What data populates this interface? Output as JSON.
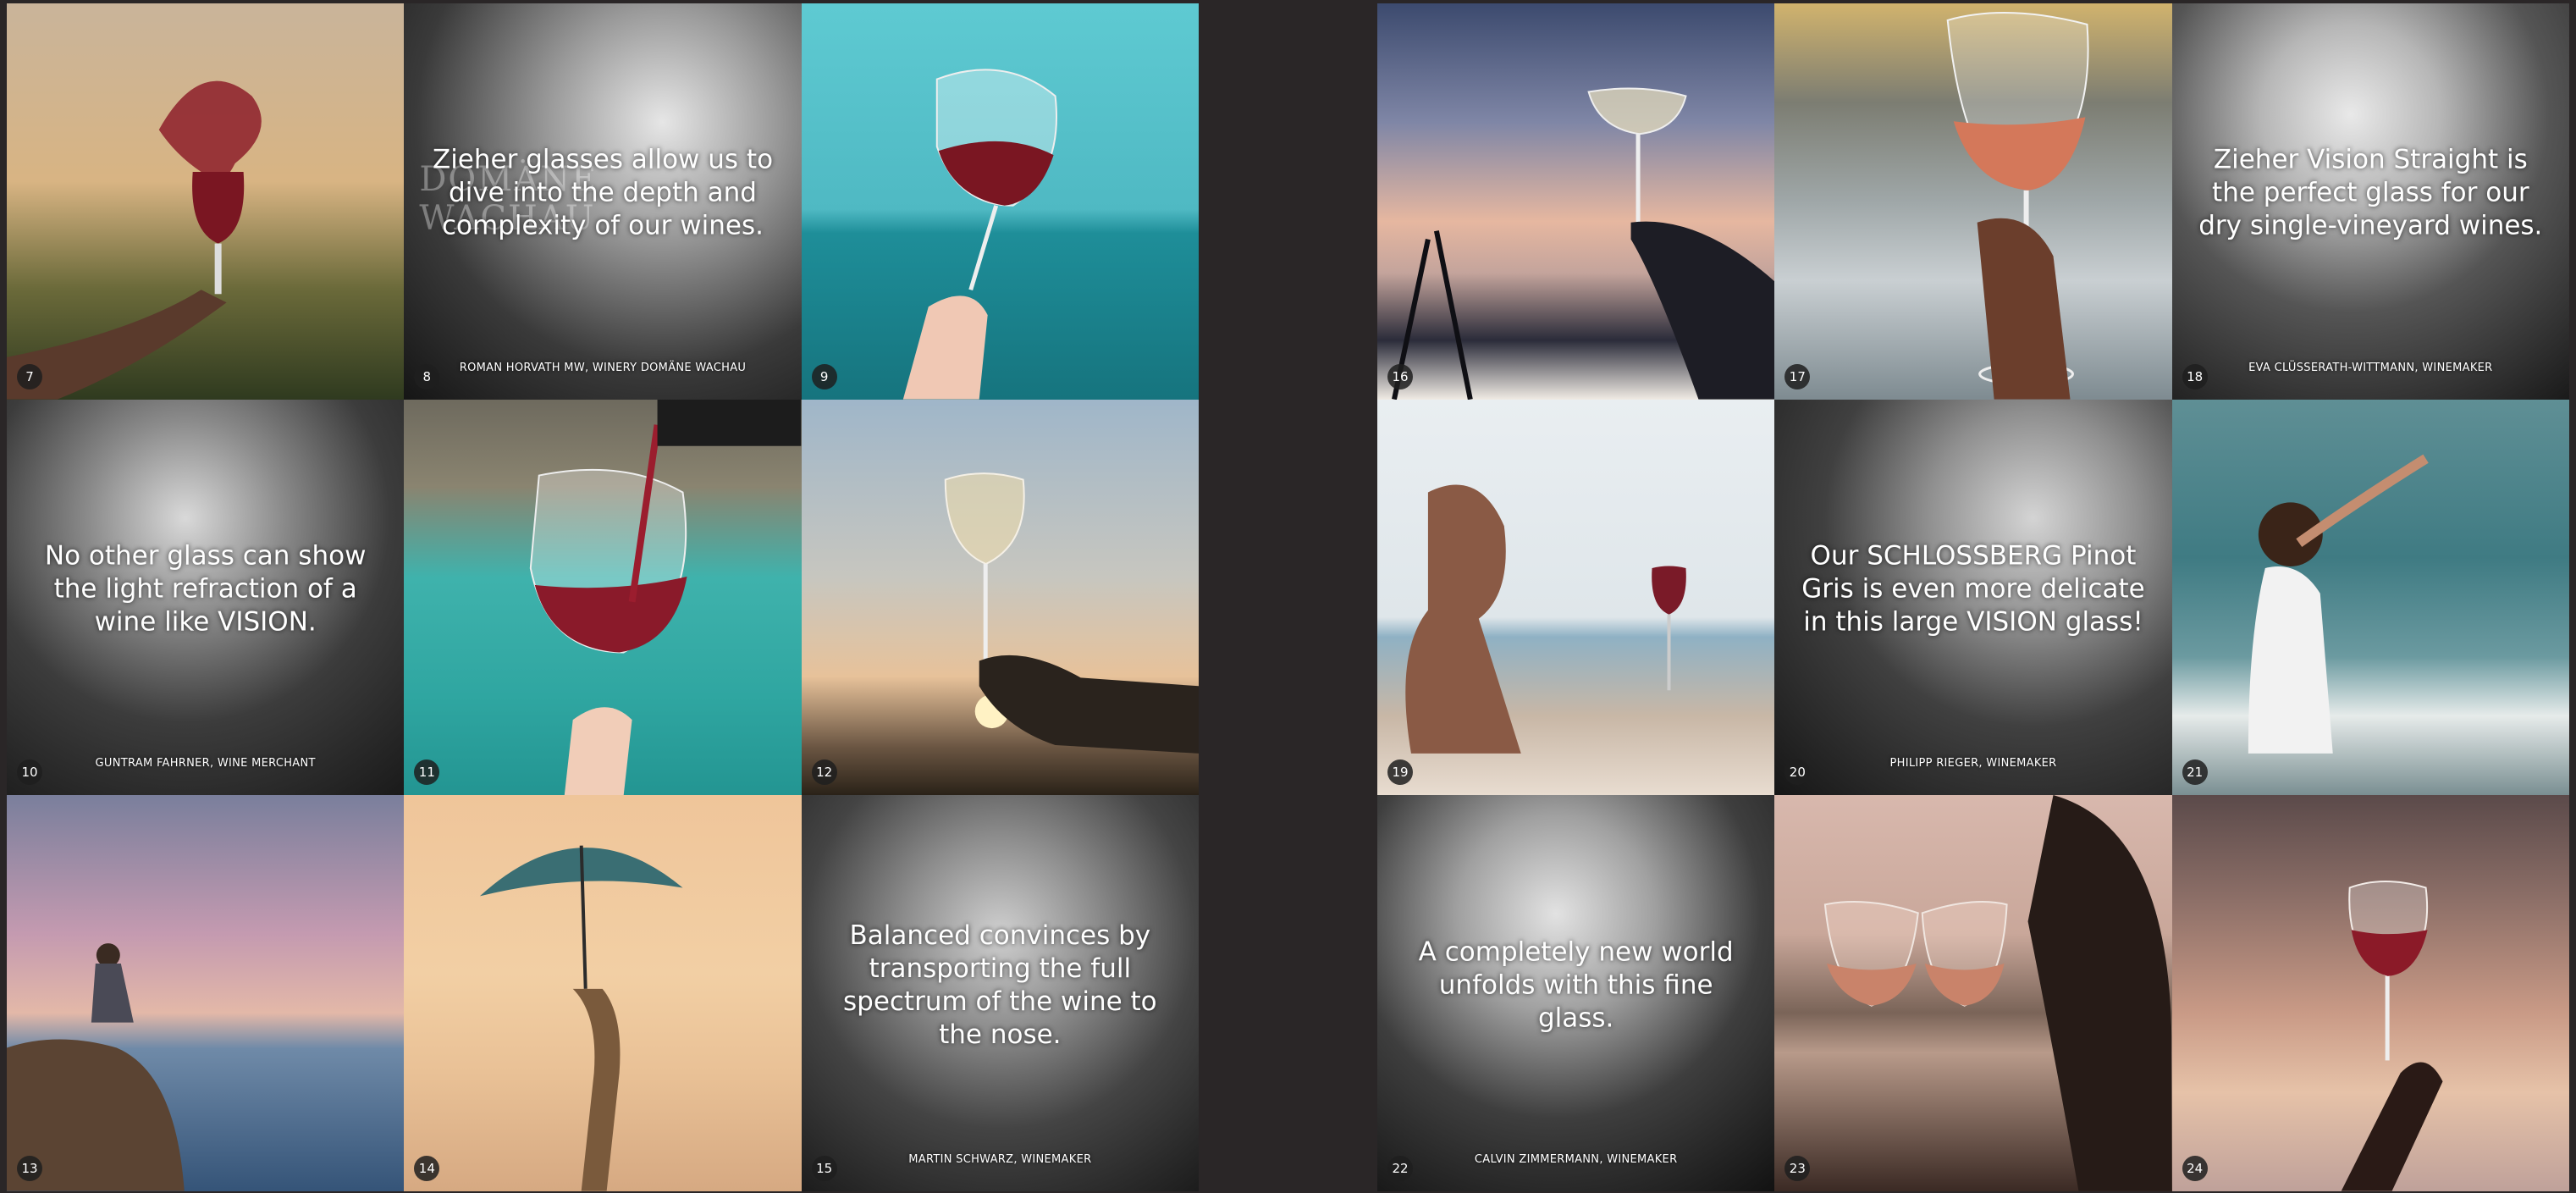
{
  "signage": {
    "line1": "DOMÄNE",
    "line2": "WACHAU"
  },
  "left_page": {
    "tiles": [
      {
        "number": "7",
        "quote": "",
        "attribution": ""
      },
      {
        "number": "8",
        "quote": "Zieher glasses allow us to dive into the depth and complexity of our wines.",
        "attribution": "ROMAN HORVATH MW, WINERY DOMÄNE WACHAU"
      },
      {
        "number": "9",
        "quote": "",
        "attribution": ""
      },
      {
        "number": "10",
        "quote": "No other glass can show the light refraction of a wine like VISION.",
        "attribution": "GUNTRAM FAHRNER, WINE MERCHANT"
      },
      {
        "number": "11",
        "quote": "",
        "attribution": ""
      },
      {
        "number": "12",
        "quote": "",
        "attribution": ""
      },
      {
        "number": "13",
        "quote": "",
        "attribution": ""
      },
      {
        "number": "14",
        "quote": "",
        "attribution": ""
      },
      {
        "number": "15",
        "quote": "Balanced convinces by transporting the full spectrum of the wine to the nose.",
        "attribution": "MARTIN SCHWARZ, WINEMAKER"
      }
    ]
  },
  "right_page": {
    "tiles": [
      {
        "number": "16",
        "quote": "",
        "attribution": ""
      },
      {
        "number": "17",
        "quote": "",
        "attribution": ""
      },
      {
        "number": "18",
        "quote": "Zieher Vision Straight is the perfect glass for our dry single-vineyard wines.",
        "attribution": "EVA CLÜSSERATH-WITTMANN, WINEMAKER"
      },
      {
        "number": "19",
        "quote": "",
        "attribution": ""
      },
      {
        "number": "20",
        "quote": "Our SCHLOSSBERG Pinot Gris is even more delicate in this large VISION glass!",
        "attribution": "PHILIPP RIEGER, WINEMAKER"
      },
      {
        "number": "21",
        "quote": "",
        "attribution": ""
      },
      {
        "number": "22",
        "quote": "A completely new world unfolds with this fine glass.",
        "attribution": "CALVIN ZIMMERMANN, WINEMAKER"
      },
      {
        "number": "23",
        "quote": "",
        "attribution": ""
      },
      {
        "number": "24",
        "quote": "",
        "attribution": ""
      }
    ]
  }
}
